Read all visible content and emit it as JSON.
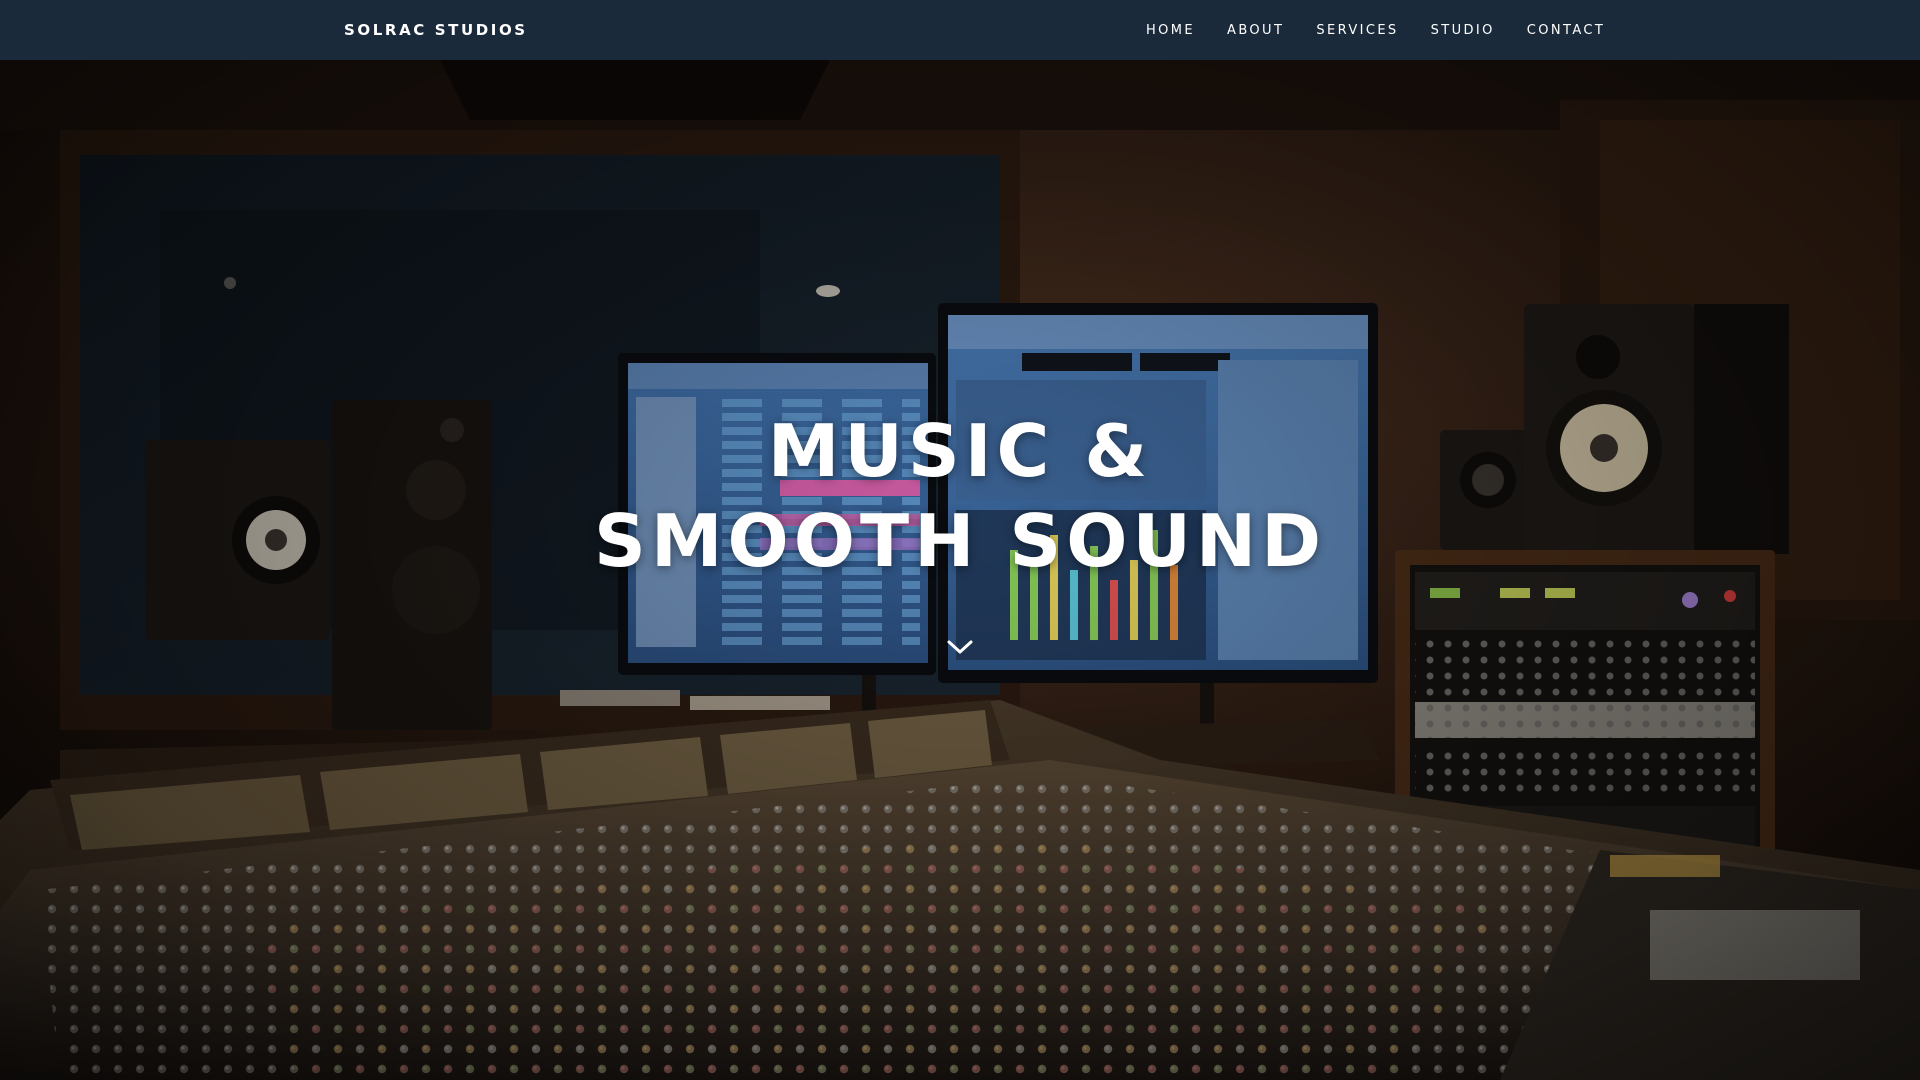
{
  "nav": {
    "brand": "SOLRAC STUDIOS",
    "items": [
      {
        "label": "HOME"
      },
      {
        "label": "ABOUT"
      },
      {
        "label": "SERVICES"
      },
      {
        "label": "STUDIO"
      },
      {
        "label": "CONTACT"
      }
    ]
  },
  "hero": {
    "title_line1": "MUSIC &",
    "title_line2": "SMOOTH SOUND",
    "scroll_icon": "chevron-down-icon"
  },
  "colors": {
    "nav_bg": "#1b2a3b",
    "nav_text": "#ffffff",
    "hero_text": "#ffffff"
  }
}
